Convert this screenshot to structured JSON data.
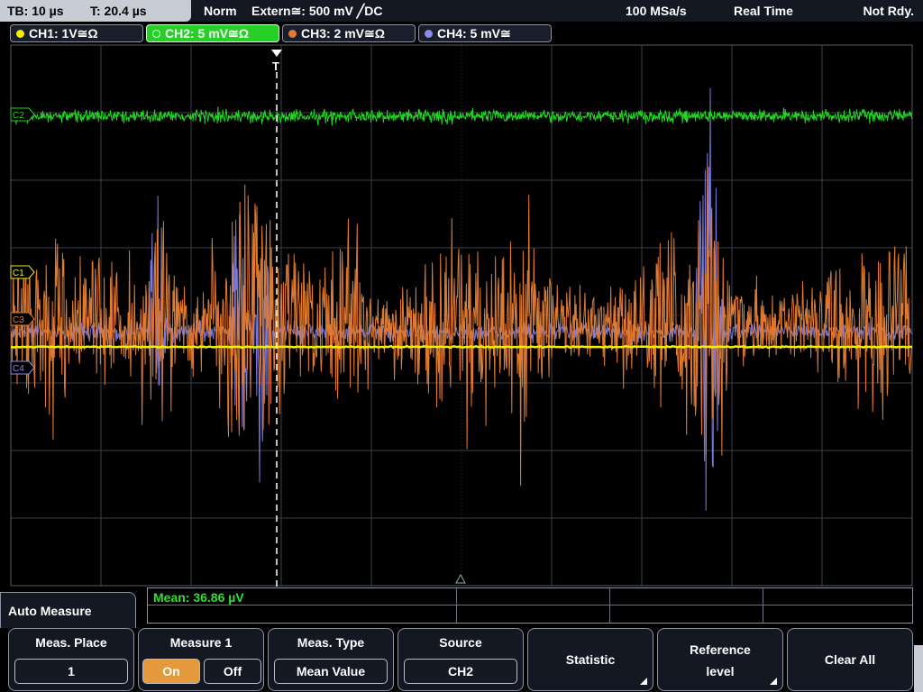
{
  "status_bar": {
    "timebase": "TB: 10 µs",
    "trigger_time": "T: 20.4 µs",
    "trigger_mode": "Norm",
    "trigger_source": "Extern≅: 500 mV ╱DC",
    "sample_rate": "100 MSa/s",
    "acquisition_mode": "Real Time",
    "status": "Not Rdy."
  },
  "channels": [
    {
      "label": "CH1: 1V≅Ω",
      "color": "#f0f000"
    },
    {
      "label": "CH2: 5 mV≅Ω",
      "color": "#22d422"
    },
    {
      "label": "CH3: 2 mV≅Ω",
      "color": "#e07a30"
    },
    {
      "label": "CH4: 5 mV≅",
      "color": "#8a8ae8"
    }
  ],
  "channel_markers": {
    "ch1": "C1",
    "ch2": "C2",
    "ch3": "C3",
    "ch4": "C4"
  },
  "trigger_marker": "T",
  "measurement": {
    "result": "Mean: 36.86 µV"
  },
  "menu": {
    "title": "Auto Measure",
    "meas_place": {
      "label": "Meas. Place",
      "value": "1"
    },
    "measure1": {
      "label": "Measure 1",
      "on": "On",
      "off": "Off"
    },
    "meas_type": {
      "label": "Meas. Type",
      "value": "Mean Value"
    },
    "source": {
      "label": "Source",
      "value": "CH2"
    },
    "statistic": {
      "label": "Statistic"
    },
    "reference_level": {
      "line1": "Reference",
      "line2": "level"
    },
    "clear_all": {
      "label": "Clear All"
    }
  }
}
